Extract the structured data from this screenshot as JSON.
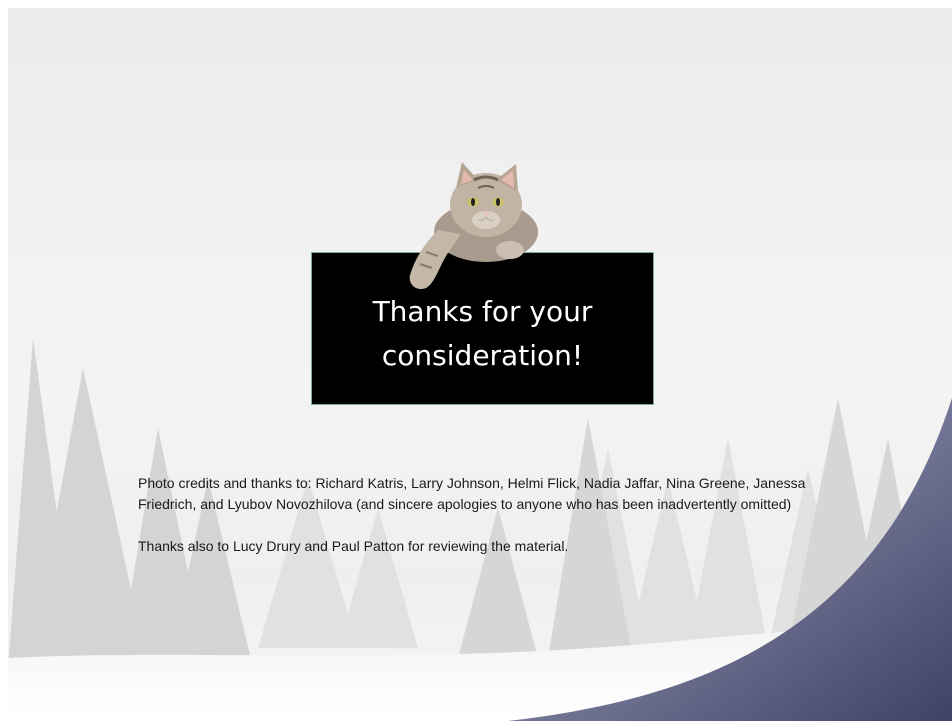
{
  "slide": {
    "sign_text": "Thanks for your consideration!",
    "credits": "Photo credits and thanks to: Richard Katris, Larry Johnson, Helmi Flick, Nadia Jaffar, Nina Greene, Janessa Friedrich,  and Lyubov Novozhilova (and sincere apologies to anyone who has been inadvertently omitted)",
    "reviewers": "Thanks also to Lucy Drury and Paul Patton for reviewing the material."
  },
  "colors": {
    "sign_background": "#000000",
    "sign_text": "#ffffff",
    "swoosh": "#4f5277",
    "snow_trees": "#d2d2d2"
  },
  "icons": {
    "cat": "cat-peeking-illustration"
  }
}
